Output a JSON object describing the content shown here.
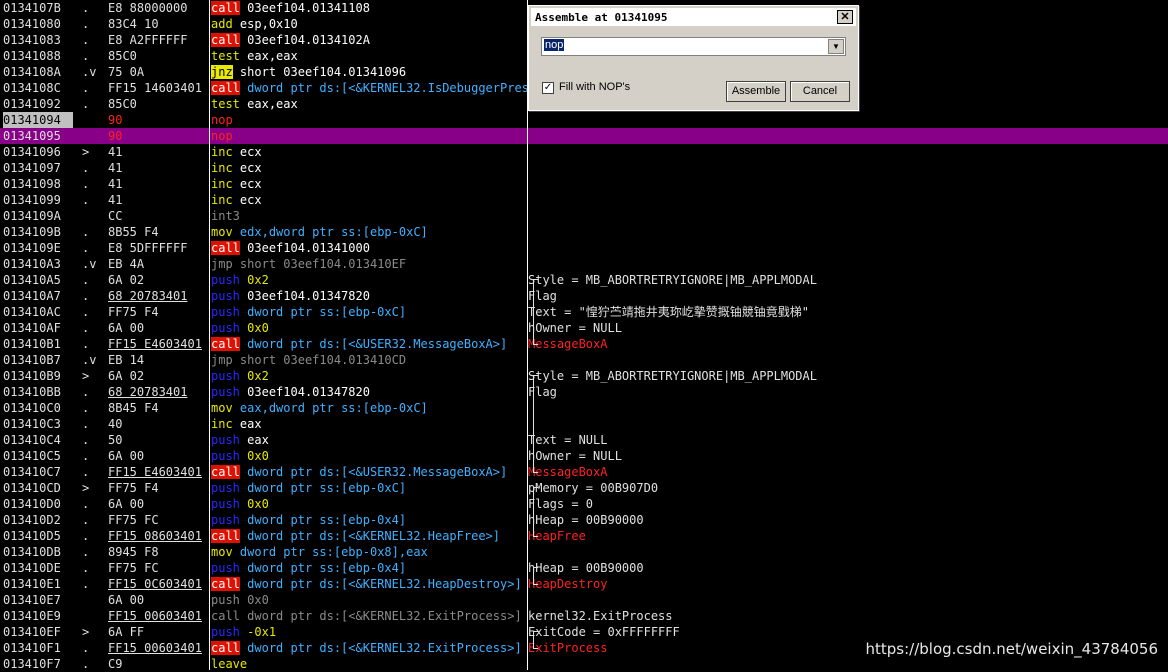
{
  "rows": [
    {
      "addr": "0134107B",
      "mark": ".",
      "hex": "E8 88000000",
      "mn": "call",
      "mc": "call",
      "op": "03eef104.01341108",
      "oc": "normal",
      "cmt": ""
    },
    {
      "addr": "01341080",
      "mark": ".",
      "hex": "83C4 10",
      "mn": "add",
      "mc": "normal",
      "op": "esp,0x10",
      "oc": "normal",
      "cmt": ""
    },
    {
      "addr": "01341083",
      "mark": ".",
      "hex": "E8 A2FFFFFF",
      "mn": "call",
      "mc": "call",
      "op": "03eef104.0134102A",
      "oc": "normal",
      "cmt": ""
    },
    {
      "addr": "01341088",
      "mark": ".",
      "hex": "85C0",
      "mn": "test",
      "mc": "normal",
      "op": "eax,eax",
      "oc": "normal",
      "cmt": ""
    },
    {
      "addr": "0134108A",
      "mark": ".v",
      "hex": "75 0A",
      "mn": "jnz",
      "mc": "jmp",
      "op": "short 03eef104.01341096",
      "oc": "normal",
      "cmt": ""
    },
    {
      "addr": "0134108C",
      "mark": ".",
      "hex": "FF15 14603401",
      "mn": "call",
      "mc": "call",
      "op": "dword ptr ds:[<&KERNEL32.IsDebuggerPresent>]",
      "oc": "ptr",
      "cmt": ""
    },
    {
      "addr": "01341092",
      "mark": ".",
      "hex": "85C0",
      "mn": "test",
      "mc": "normal",
      "op": "eax,eax",
      "oc": "normal",
      "cmt": ""
    },
    {
      "addr": "01341094",
      "mark": "",
      "hex": "90",
      "mn": "nop",
      "mc": "nop",
      "op": "",
      "oc": "normal",
      "cmt": "",
      "hexred": true,
      "cur": true
    },
    {
      "addr": "01341095",
      "mark": "",
      "hex": "90",
      "mn": "nop",
      "mc": "nop",
      "op": "",
      "oc": "normal",
      "cmt": "",
      "hexred": true,
      "sel": true
    },
    {
      "addr": "01341096",
      "mark": ">",
      "hex": "41",
      "mn": "inc",
      "mc": "normal",
      "op": "ecx",
      "oc": "normal",
      "cmt": ""
    },
    {
      "addr": "01341097",
      "mark": ".",
      "hex": "41",
      "mn": "inc",
      "mc": "normal",
      "op": "ecx",
      "oc": "normal",
      "cmt": ""
    },
    {
      "addr": "01341098",
      "mark": ".",
      "hex": "41",
      "mn": "inc",
      "mc": "normal",
      "op": "ecx",
      "oc": "normal",
      "cmt": ""
    },
    {
      "addr": "01341099",
      "mark": ".",
      "hex": "41",
      "mn": "inc",
      "mc": "normal",
      "op": "ecx",
      "oc": "normal",
      "cmt": ""
    },
    {
      "addr": "0134109A",
      "mark": "",
      "hex": "CC",
      "mn": "int3",
      "mc": "gray",
      "op": "",
      "oc": "normal",
      "cmt": ""
    },
    {
      "addr": "0134109B",
      "mark": ".",
      "hex": "8B55 F4",
      "mn": "mov",
      "mc": "normal",
      "op": "edx,dword ptr ss:[ebp-0xC]",
      "oc": "ptr",
      "cmt": ""
    },
    {
      "addr": "0134109E",
      "mark": ".",
      "hex": "E8 5DFFFFFF",
      "mn": "call",
      "mc": "call",
      "op": "03eef104.01341000",
      "oc": "normal",
      "cmt": ""
    },
    {
      "addr": "013410A3",
      "mark": ".v",
      "hex": "EB 4A",
      "mn": "jmp",
      "mc": "gray",
      "op": "short 03eef104.013410EF",
      "oc": "gray",
      "cmt": ""
    },
    {
      "addr": "013410A5",
      "mark": ".",
      "hex": "6A 02",
      "mn": "push",
      "mc": "push",
      "op": "0x2",
      "oc": "num",
      "cmt": "Style = MB_ABORTRETRYIGNORE|MB_APPLMODAL"
    },
    {
      "addr": "013410A7",
      "mark": ".",
      "hex": "68 20783401",
      "mn": "push",
      "mc": "push",
      "op": "03eef104.01347820",
      "oc": "normal",
      "cmt": "Flag",
      "hexul": true
    },
    {
      "addr": "013410AC",
      "mark": ".",
      "hex": "FF75 F4",
      "mn": "push",
      "mc": "push",
      "op": "dword ptr ss:[ebp-0xC]",
      "oc": "ptr",
      "cmt": "Text = \"惶狞苎靖拖井夷珎屹摰赞摡铀競铀竟戥梯\""
    },
    {
      "addr": "013410AF",
      "mark": ".",
      "hex": "6A 00",
      "mn": "push",
      "mc": "push",
      "op": "0x0",
      "oc": "num",
      "cmt": "hOwner = NULL"
    },
    {
      "addr": "013410B1",
      "mark": ".",
      "hex": "FF15 E4603401",
      "mn": "call",
      "mc": "call",
      "op": "dword ptr ds:[<&USER32.MessageBoxA>]",
      "oc": "ptr",
      "cmt": "MessageBoxA",
      "cmtred": true,
      "hexul": true
    },
    {
      "addr": "013410B7",
      "mark": ".v",
      "hex": "EB 14",
      "mn": "jmp",
      "mc": "gray",
      "op": "short 03eef104.013410CD",
      "oc": "gray",
      "cmt": ""
    },
    {
      "addr": "013410B9",
      "mark": ">",
      "hex": "6A 02",
      "mn": "push",
      "mc": "push",
      "op": "0x2",
      "oc": "num",
      "cmt": "Style = MB_ABORTRETRYIGNORE|MB_APPLMODAL"
    },
    {
      "addr": "013410BB",
      "mark": ".",
      "hex": "68 20783401",
      "mn": "push",
      "mc": "push",
      "op": "03eef104.01347820",
      "oc": "normal",
      "cmt": "Flag",
      "hexul": true
    },
    {
      "addr": "013410C0",
      "mark": ".",
      "hex": "8B45 F4",
      "mn": "mov",
      "mc": "normal",
      "op": "eax,dword ptr ss:[ebp-0xC]",
      "oc": "ptr",
      "cmt": ""
    },
    {
      "addr": "013410C3",
      "mark": ".",
      "hex": "40",
      "mn": "inc",
      "mc": "normal",
      "op": "eax",
      "oc": "normal",
      "cmt": ""
    },
    {
      "addr": "013410C4",
      "mark": ".",
      "hex": "50",
      "mn": "push",
      "mc": "push",
      "op": "eax",
      "oc": "normal",
      "cmt": "Text = NULL"
    },
    {
      "addr": "013410C5",
      "mark": ".",
      "hex": "6A 00",
      "mn": "push",
      "mc": "push",
      "op": "0x0",
      "oc": "num",
      "cmt": "hOwner = NULL"
    },
    {
      "addr": "013410C7",
      "mark": ".",
      "hex": "FF15 E4603401",
      "mn": "call",
      "mc": "call",
      "op": "dword ptr ds:[<&USER32.MessageBoxA>]",
      "oc": "ptr",
      "cmt": "MessageBoxA",
      "cmtred": true,
      "hexul": true
    },
    {
      "addr": "013410CD",
      "mark": ">",
      "hex": "FF75 F4",
      "mn": "push",
      "mc": "push",
      "op": "dword ptr ss:[ebp-0xC]",
      "oc": "ptr",
      "cmt": "pMemory = 00B907D0"
    },
    {
      "addr": "013410D0",
      "mark": ".",
      "hex": "6A 00",
      "mn": "push",
      "mc": "push",
      "op": "0x0",
      "oc": "num",
      "cmt": "Flags = 0"
    },
    {
      "addr": "013410D2",
      "mark": ".",
      "hex": "FF75 FC",
      "mn": "push",
      "mc": "push",
      "op": "dword ptr ss:[ebp-0x4]",
      "oc": "ptr",
      "cmt": "hHeap = 00B90000"
    },
    {
      "addr": "013410D5",
      "mark": ".",
      "hex": "FF15 08603401",
      "mn": "call",
      "mc": "call",
      "op": "dword ptr ds:[<&KERNEL32.HeapFree>]",
      "oc": "ptr",
      "cmt": "HeapFree",
      "cmtred": true,
      "hexul": true
    },
    {
      "addr": "013410DB",
      "mark": ".",
      "hex": "8945 F8",
      "mn": "mov",
      "mc": "normal",
      "op": "dword ptr ss:[ebp-0x8],eax",
      "oc": "ptr",
      "cmt": ""
    },
    {
      "addr": "013410DE",
      "mark": ".",
      "hex": "FF75 FC",
      "mn": "push",
      "mc": "push",
      "op": "dword ptr ss:[ebp-0x4]",
      "oc": "ptr",
      "cmt": "hHeap = 00B90000"
    },
    {
      "addr": "013410E1",
      "mark": ".",
      "hex": "FF15 0C603401",
      "mn": "call",
      "mc": "call",
      "op": "dword ptr ds:[<&KERNEL32.HeapDestroy>]",
      "oc": "ptr",
      "cmt": "HeapDestroy",
      "cmtred": true,
      "hexul": true
    },
    {
      "addr": "013410E7",
      "mark": "",
      "hex": "6A 00",
      "mn": "push",
      "mc": "gray",
      "op": "0x0",
      "oc": "gray",
      "cmt": ""
    },
    {
      "addr": "013410E9",
      "mark": "",
      "hex": "FF15 00603401",
      "mn": "call",
      "mc": "gray",
      "op": "dword ptr ds:[<&KERNEL32.ExitProcess>]",
      "oc": "gray",
      "cmt": "kernel32.ExitProcess",
      "hexul": true
    },
    {
      "addr": "013410EF",
      "mark": ">",
      "hex": "6A FF",
      "mn": "push",
      "mc": "push",
      "op": "-0x1",
      "oc": "num",
      "cmt": "ExitCode = 0xFFFFFFFF"
    },
    {
      "addr": "013410F1",
      "mark": ".",
      "hex": "FF15 00603401",
      "mn": "call",
      "mc": "call",
      "op": "dword ptr ds:[<&KERNEL32.ExitProcess>]",
      "oc": "ptr",
      "cmt": "ExitProcess",
      "cmtred": true,
      "hexul": true
    },
    {
      "addr": "013410F7",
      "mark": ".",
      "hex": "C9",
      "mn": "leave",
      "mc": "normal",
      "op": "",
      "oc": "normal",
      "cmt": ""
    }
  ],
  "dialog": {
    "title": "Assemble at 01341095",
    "input_value": "nop",
    "checkbox_label": "Fill with NOP's",
    "checkbox_checked": true,
    "assemble_label": "Assemble",
    "cancel_label": "Cancel",
    "close_glyph": "✕"
  },
  "watermark": "https://blog.csdn.net/weixin_43784056"
}
